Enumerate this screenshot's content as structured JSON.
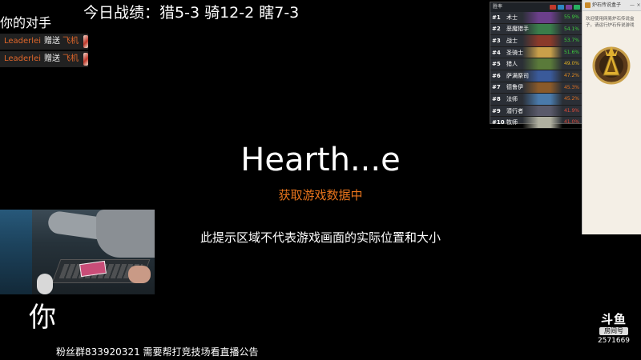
{
  "stream": {
    "today_record": "今日战绩：猎5-3 骑12-2 瞎7-3",
    "opponent_label": "你的对手",
    "you_label": "你",
    "fan_group": "粉丝群833920321 需要帮打竞技场看直播公告"
  },
  "gifts": [
    {
      "user": "Leaderlei",
      "verb": "赠送",
      "item": "飞机"
    },
    {
      "user": "Leaderlei",
      "verb": "赠送",
      "item": "飞机"
    }
  ],
  "loading": {
    "title": "Hearth...e",
    "status": "获取游戏数据中",
    "hint": "此提示区域不代表游戏画面的实际位置和大小"
  },
  "rank_panel": {
    "header": "胜率",
    "header_colors": [
      "#c0392b",
      "#2e86c1",
      "#7d3c98",
      "#27ae60"
    ],
    "rows": [
      {
        "num": "#1",
        "cls": "术士",
        "pct": "55.9%",
        "pct_color": "#3ecf3e",
        "art_color": "#6b3f8a"
      },
      {
        "num": "#2",
        "cls": "恶魔猎手",
        "pct": "54.1%",
        "pct_color": "#3ecf3e",
        "art_color": "#3a7d4a"
      },
      {
        "num": "#3",
        "cls": "战士",
        "pct": "53.7%",
        "pct_color": "#3ecf3e",
        "art_color": "#8a3a2a"
      },
      {
        "num": "#4",
        "cls": "圣骑士",
        "pct": "51.6%",
        "pct_color": "#3ecf3e",
        "art_color": "#c9a04a"
      },
      {
        "num": "#5",
        "cls": "猎人",
        "pct": "49.0%",
        "pct_color": "#e0b020",
        "art_color": "#5a7a3a"
      },
      {
        "num": "#6",
        "cls": "萨满祭司",
        "pct": "47.2%",
        "pct_color": "#e08a20",
        "art_color": "#3a5a9a"
      },
      {
        "num": "#7",
        "cls": "德鲁伊",
        "pct": "45.3%",
        "pct_color": "#e07020",
        "art_color": "#8a5a2a"
      },
      {
        "num": "#8",
        "cls": "法师",
        "pct": "45.2%",
        "pct_color": "#e07020",
        "art_color": "#4a7aaa"
      },
      {
        "num": "#9",
        "cls": "潜行者",
        "pct": "41.9%",
        "pct_color": "#e04a3a",
        "art_color": "#5a5a6a"
      },
      {
        "num": "#10",
        "cls": "牧师",
        "pct": "41.0%",
        "pct_color": "#e04a3a",
        "art_color": "#b0b0a0"
      }
    ]
  },
  "tracker": {
    "title": "炉石传说盒子",
    "welcome": "欢迎使用网易炉石传说盒子。请运行炉石传说游戏",
    "buttons": [
      "—",
      "×"
    ]
  },
  "douyu": {
    "logo": "斗鱼",
    "room_label": "房间号",
    "room_id": "2571669"
  }
}
